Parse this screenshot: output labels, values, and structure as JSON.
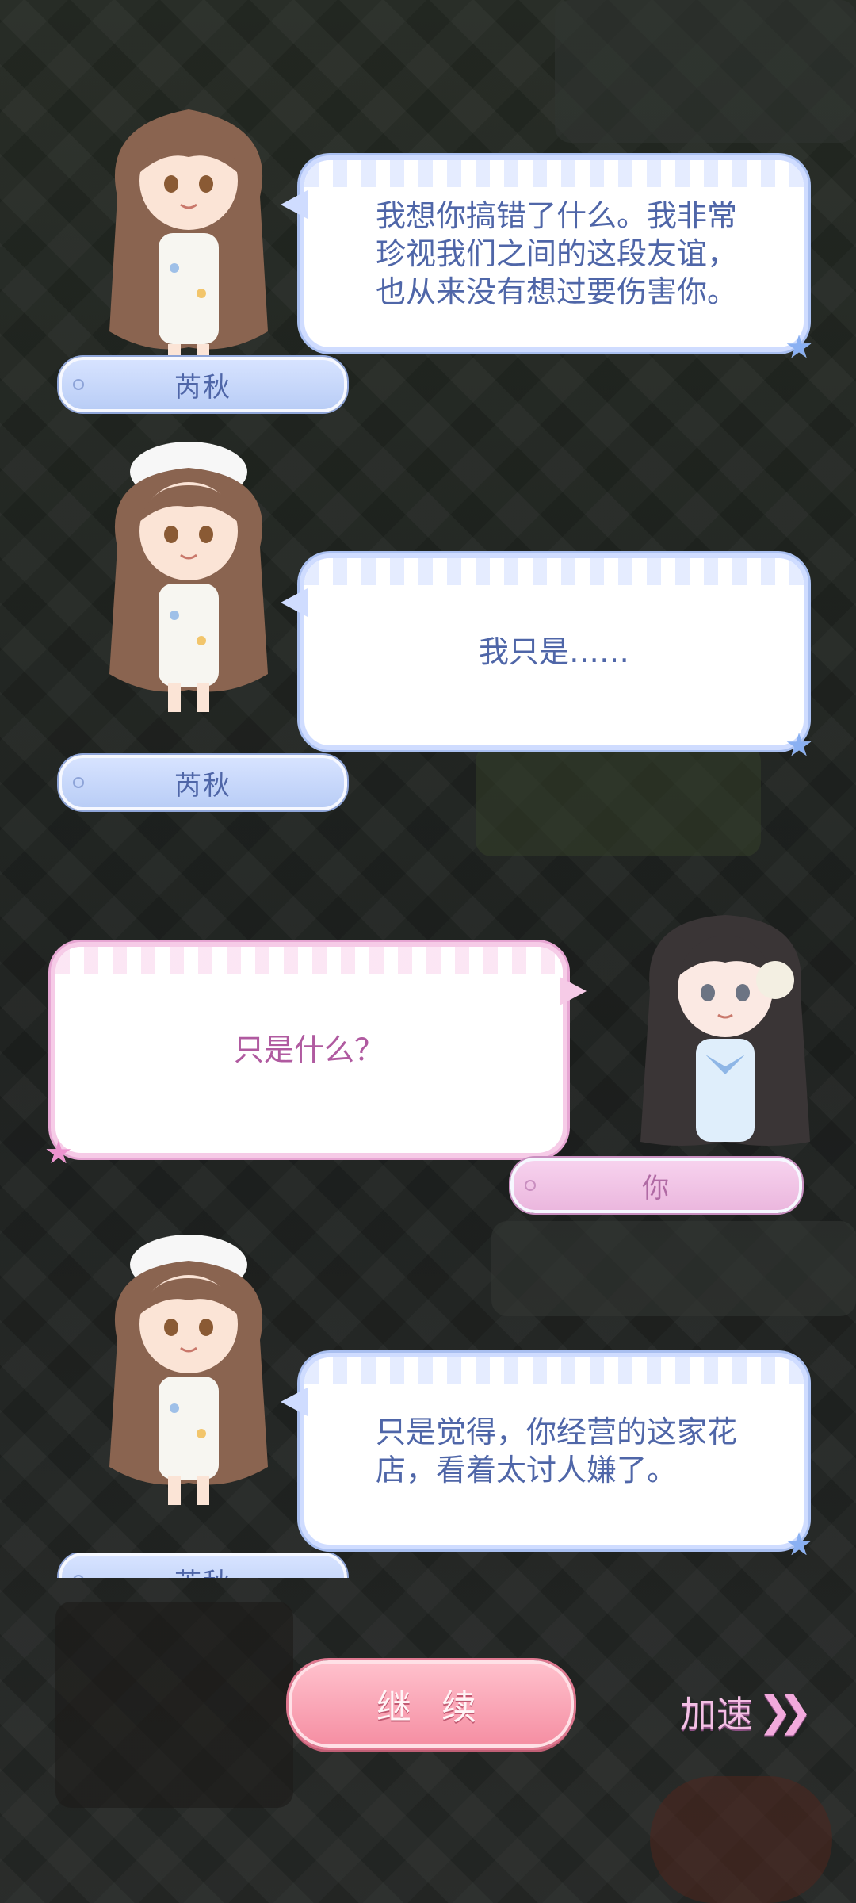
{
  "dialogue": [
    {
      "speaker": "芮秋",
      "text": "我想你搞错了什么。我非常珍视我们之间的这段友谊，也从来没有想过要伤害你。"
    },
    {
      "speaker": "芮秋",
      "text": "我只是……"
    },
    {
      "speaker": "你",
      "text": "只是什么？"
    },
    {
      "speaker": "芮秋",
      "text": "只是觉得，你经营的这家花店，看着太讨人嫌了。"
    }
  ],
  "controls": {
    "continue_label": "继 续",
    "speed_label": "加速",
    "speed_icon": "double-chevron-right-icon"
  },
  "colors": {
    "npc_bubble_border": "#cfdcff",
    "npc_text": "#4f66a8",
    "player_bubble_border": "#f6cbe7",
    "player_text": "#b05aa0",
    "continue_button": "#f58fa3"
  }
}
